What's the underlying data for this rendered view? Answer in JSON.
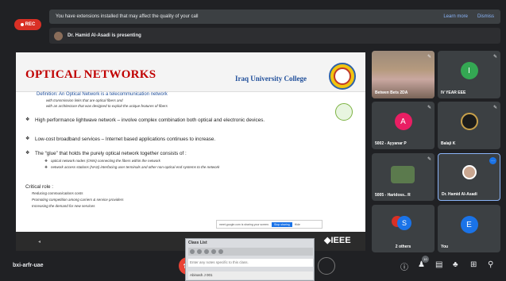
{
  "top": {
    "rec": "REC",
    "banner_message": "You have extensions installed that may affect the quality of your call",
    "learn_more": "Learn more",
    "dismiss": "Dismiss",
    "presenting": "Dr. Hamid Al-Asadi is presenting"
  },
  "slide": {
    "title": "OPTICAL NETWORKS",
    "college": "Iraq University College",
    "definition": "Definition: An Optical Network is a telecommunication network",
    "def_sub1": "with transmission links that are optical fibers and",
    "def_sub2": "with an architecture that was designed to exploit the unique features of fibers",
    "bullet1": "High performance lightwave network – involve complex combination both optical and electronic devices.",
    "bullet2": "Low-cost broadband services – Internet based applications continues to increase.",
    "bullet3": "The “glue” that holds the purely optical network together consists of :",
    "glue_sub1": "optical network nodes (ONN) connecting the fibers within the network",
    "glue_sub2": "network access stations (NAS) interfacing user terminals and other non-optical end systems to the network",
    "critical_role": "Critical role :",
    "role1": "Reducing communications costs",
    "role2": "Promoting competition among carriers & service providers",
    "role3": "Increasing the demand for new services",
    "footer_brand": "◆IEEE"
  },
  "share_toast": {
    "text": "meet.google.com is sharing your screen.",
    "stop": "Stop sharing",
    "hide": "Hide"
  },
  "tiles": [
    {
      "name": "Betwen Bets 2DA",
      "avatar": ""
    },
    {
      "name": "IV YEAR EEE",
      "avatar": "I"
    },
    {
      "name": "5002 - Ayyanar P",
      "avatar": "A"
    },
    {
      "name": "Balaji K",
      "avatar": ""
    },
    {
      "name": "5005 - Haridoss.. R",
      "avatar": ""
    },
    {
      "name": "Dr. Hamid Al-Asadi",
      "avatar": ""
    },
    {
      "name": "2 others",
      "avatar": "S"
    },
    {
      "name": "You",
      "avatar": "E"
    }
  ],
  "classlist": {
    "title": "Class List",
    "notes_placeholder": "Enter any notes specific to this class.",
    "student": "Abinash J 001"
  },
  "bottom": {
    "meeting_code": "bxi-arfr-uae",
    "people_count": "10"
  },
  "colors": {
    "background": "#202124",
    "tile": "#3c4043",
    "hangup": "#ea4335",
    "accent": "#1a73e8",
    "slide_title": "#c00000"
  }
}
